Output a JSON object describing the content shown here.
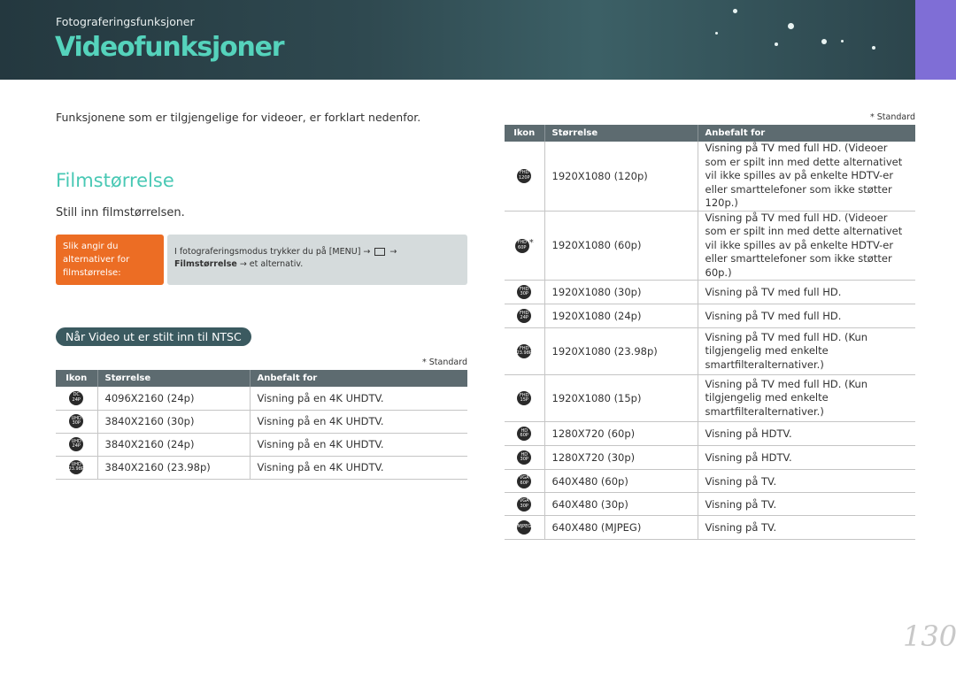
{
  "header": {
    "breadcrumb": "Fotograferingsfunksjoner",
    "title": "Videofunksjoner"
  },
  "intro": "Funksjonene som er tilgjengelige for videoer, er forklart nedenfor.",
  "section": {
    "title": "Filmstørrelse",
    "step": "Still inn filmstørrelsen."
  },
  "howto": {
    "label": "Slik angir du alternativer for filmstørrelse:",
    "text_before": "I fotograferingsmodus trykker du på [MENU] → ",
    "text_arrow": " →",
    "bold": "Filmstørrelse",
    "text_after": " → et alternativ."
  },
  "ntsc_pill": "Når Video ut er stilt inn til NTSC",
  "standard_note": "* Standard",
  "columns": {
    "icon": "Ikon",
    "size": "Størrelse",
    "recommended": "Anbefalt for"
  },
  "left_table": [
    {
      "icon": [
        "DC",
        "24P"
      ],
      "size": "4096X2160 (24p)",
      "recommended": "Visning på en 4K UHDTV."
    },
    {
      "icon": [
        "UHD",
        "30P"
      ],
      "size": "3840X2160 (30p)",
      "recommended": "Visning på en 4K UHDTV."
    },
    {
      "icon": [
        "UHD",
        "24P"
      ],
      "size": "3840X2160 (24p)",
      "recommended": "Visning på en 4K UHDTV."
    },
    {
      "icon": [
        "UHD",
        "23.98P"
      ],
      "size": "3840X2160 (23.98p)",
      "recommended": "Visning på en 4K UHDTV."
    }
  ],
  "right_table": [
    {
      "icon": [
        "FHD",
        "120P"
      ],
      "star": "",
      "size": "1920X1080 (120p)",
      "recommended": "Visning på TV med full HD. (Videoer som er spilt inn med dette alternativet vil ikke spilles av på enkelte HDTV-er eller smarttelefoner som ikke støtter 120p.)"
    },
    {
      "icon": [
        "FHD",
        "60P"
      ],
      "star": "*",
      "size": "1920X1080 (60p)",
      "recommended": "Visning på TV med full HD. (Videoer som er spilt inn med dette alternativet vil ikke spilles av på enkelte HDTV-er eller smarttelefoner som ikke støtter 60p.)"
    },
    {
      "icon": [
        "FHD",
        "30P"
      ],
      "star": "",
      "size": "1920X1080 (30p)",
      "recommended": "Visning på TV med full HD."
    },
    {
      "icon": [
        "FHD",
        "24P"
      ],
      "star": "",
      "size": "1920X1080 (24p)",
      "recommended": "Visning på TV med full HD."
    },
    {
      "icon": [
        "FHD",
        "23.98P"
      ],
      "star": "",
      "size": "1920X1080 (23.98p)",
      "recommended": "Visning på TV med full HD. (Kun tilgjengelig med enkelte smartfilteralternativer.)"
    },
    {
      "icon": [
        "FHD",
        "15P"
      ],
      "star": "",
      "size": "1920X1080 (15p)",
      "recommended": "Visning på TV med full HD. (Kun tilgjengelig med enkelte smartfilteralternativer.)"
    },
    {
      "icon": [
        "HD",
        "60P"
      ],
      "star": "",
      "size": "1280X720 (60p)",
      "recommended": "Visning på HDTV."
    },
    {
      "icon": [
        "HD",
        "30P"
      ],
      "star": "",
      "size": "1280X720 (30p)",
      "recommended": "Visning på HDTV."
    },
    {
      "icon": [
        "VGA",
        "60P"
      ],
      "star": "",
      "size": "640X480 (60p)",
      "recommended": "Visning på TV."
    },
    {
      "icon": [
        "VGA",
        "30P"
      ],
      "star": "",
      "size": "640X480 (30p)",
      "recommended": "Visning på TV."
    },
    {
      "icon": [
        "MJPEG"
      ],
      "star": "",
      "size": "640X480 (MJPEG)",
      "recommended": "Visning på TV."
    }
  ],
  "page_number": "130"
}
